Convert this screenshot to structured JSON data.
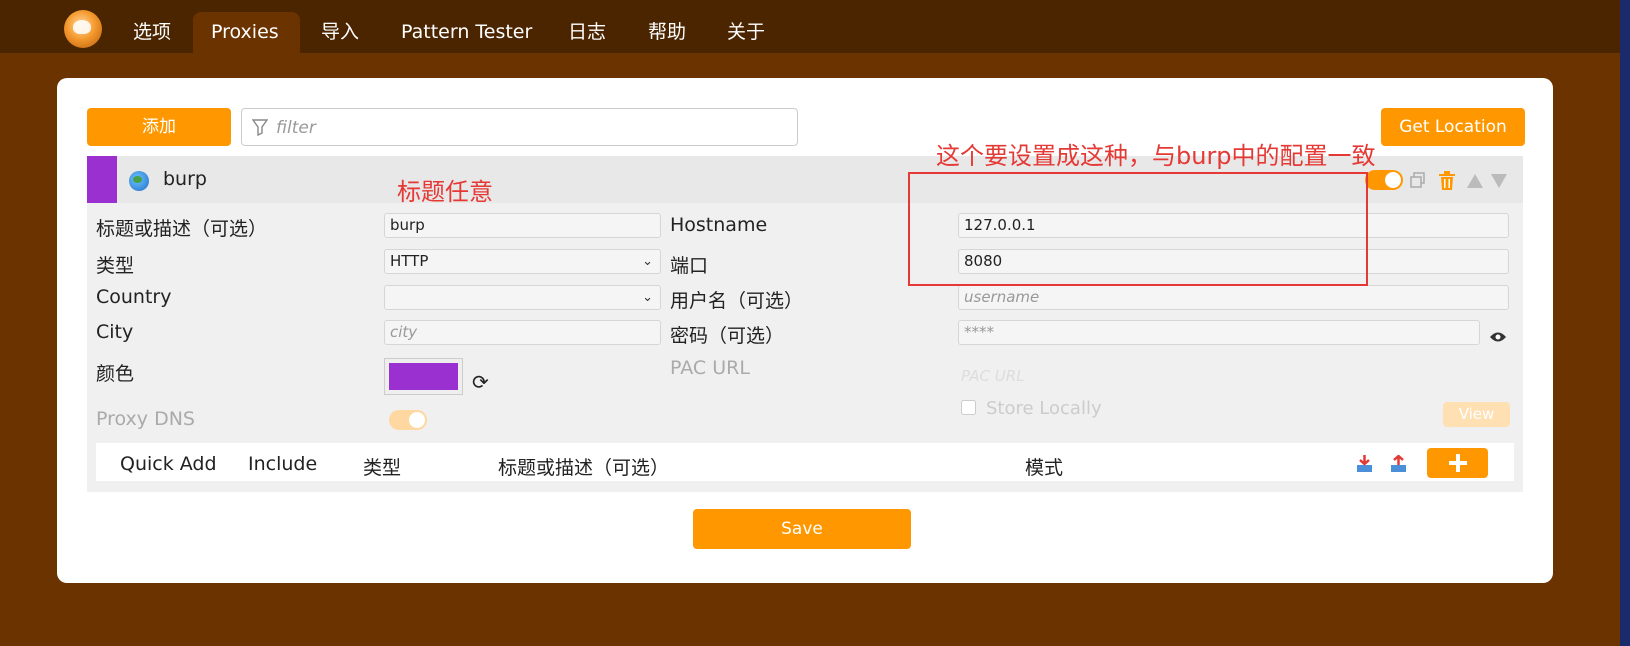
{
  "nav": {
    "tabs": [
      "选项",
      "Proxies",
      "导入",
      "Pattern Tester",
      "日志",
      "帮助",
      "关于"
    ],
    "active_tab": "Proxies"
  },
  "toolbar": {
    "add_label": "添加",
    "filter_placeholder": "filter",
    "get_location_label": "Get Location"
  },
  "proxy": {
    "name": "burp",
    "color": "#9a30d0",
    "enabled": true,
    "fields": {
      "title_label": "标题或描述（可选）",
      "title_value": "burp",
      "type_label": "类型",
      "type_value": "HTTP",
      "country_label": "Country",
      "country_value": "",
      "city_label": "City",
      "city_placeholder": "city",
      "color_label": "颜色",
      "proxy_dns_label": "Proxy DNS",
      "hostname_label": "Hostname",
      "hostname_value": "127.0.0.1",
      "port_label": "端口",
      "port_value": "8080",
      "username_label": "用户名（可选）",
      "username_placeholder": "username",
      "password_label": "密码（可选）",
      "password_placeholder": "****",
      "pac_url_label": "PAC URL",
      "pac_url_placeholder": "PAC URL",
      "store_locally_label": "Store Locally",
      "view_label": "View"
    }
  },
  "patterns": {
    "headers": [
      "Quick Add",
      "Include",
      "类型",
      "标题或描述（可选）",
      "模式"
    ]
  },
  "save_label": "Save",
  "annotations": {
    "title_note": "标题任意",
    "config_note": "这个要设置成这种，与burp中的配置一致"
  },
  "colors": {
    "accent": "#ff9800",
    "header_bg": "#4a2500",
    "page_bg": "#6b3300"
  }
}
